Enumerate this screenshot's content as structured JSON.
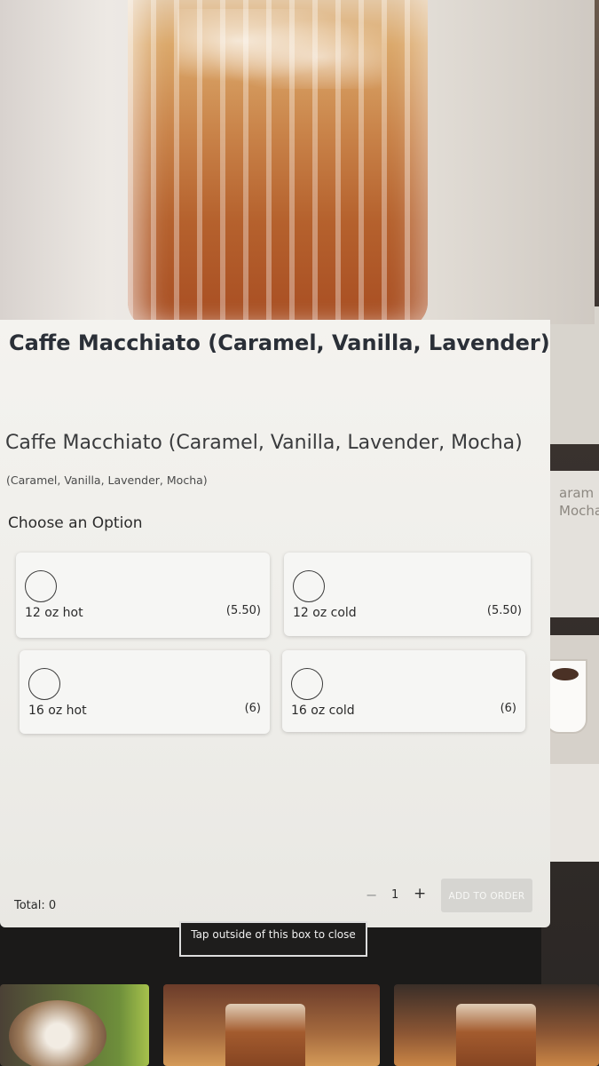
{
  "product": {
    "title": "Caffe Macchiato (Caramel, Vanilla, Lavender)",
    "subtitle": "Caffe Macchiato (Caramel, Vanilla, Lavender, Mocha)",
    "description": "(Caramel, Vanilla, Lavender, Mocha)"
  },
  "options_heading": "Choose an Option",
  "options": [
    {
      "name": "12 oz hot",
      "price": "(5.50)"
    },
    {
      "name": "12 oz cold",
      "price": "(5.50)"
    },
    {
      "name": "16 oz hot",
      "price": "(6)"
    },
    {
      "name": "16 oz cold",
      "price": "(6)"
    }
  ],
  "footer": {
    "total": "Total: 0",
    "minus": "−",
    "quantity": "1",
    "plus": "+",
    "add_button": "ADD TO ORDER"
  },
  "close_hint": "Tap outside of this box to close",
  "background_card_text": [
    "aram",
    "Mocha"
  ]
}
